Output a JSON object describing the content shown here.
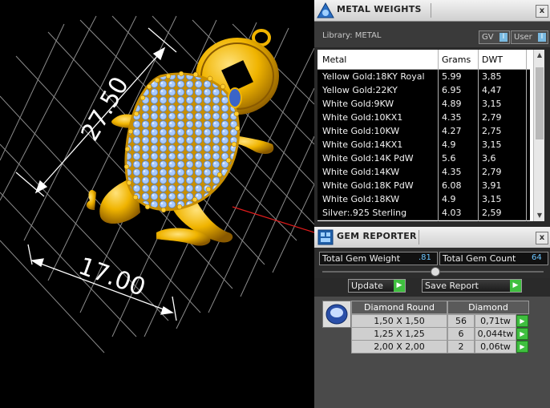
{
  "viewport": {
    "dim_vertical": "27.50",
    "dim_horizontal": "17.00"
  },
  "metal_weights": {
    "title": "METAL WEIGHTS",
    "close_label": "x",
    "library_label": "Library: METAL",
    "gv_label": "GV",
    "user_label": "User",
    "columns": [
      "Metal",
      "Grams",
      "DWT"
    ],
    "rows": [
      {
        "metal": "Yellow Gold:18KY Royal",
        "grams": "5.99",
        "dwt": "3,85"
      },
      {
        "metal": "Yellow Gold:22KY",
        "grams": "6.95",
        "dwt": "4,47"
      },
      {
        "metal": "White Gold:9KW",
        "grams": "4.89",
        "dwt": "3,15"
      },
      {
        "metal": "White Gold:10KX1",
        "grams": "4.35",
        "dwt": "2,79"
      },
      {
        "metal": "White Gold:10KW",
        "grams": "4.27",
        "dwt": "2,75"
      },
      {
        "metal": "White Gold:14KX1",
        "grams": "4.9",
        "dwt": "3,15"
      },
      {
        "metal": "White Gold:14K PdW",
        "grams": "5.6",
        "dwt": "3,6"
      },
      {
        "metal": "White Gold:14KW",
        "grams": "4.35",
        "dwt": "2,79"
      },
      {
        "metal": "White Gold:18K PdW",
        "grams": "6.08",
        "dwt": "3,91"
      },
      {
        "metal": "White Gold:18KW",
        "grams": "4.9",
        "dwt": "3,15"
      },
      {
        "metal": "Silver:.925 Sterling",
        "grams": "4.03",
        "dwt": "2,59"
      }
    ]
  },
  "gem_reporter": {
    "title": "GEM REPORTER",
    "close_label": "x",
    "total_weight_label": "Total Gem Weight",
    "total_weight_value": ".81",
    "total_count_label": "Total Gem Count",
    "total_count_value": "64",
    "update_label": "Update",
    "save_label": "Save Report",
    "gem_shape": "Diamond Round",
    "gem_type": "Diamond",
    "gems": [
      {
        "size": "1,50 X 1,50",
        "count": "56",
        "weight": "0,71tw"
      },
      {
        "size": "1,25 X 1,25",
        "count": "6",
        "weight": "0,044tw"
      },
      {
        "size": "2,00 X 2,00",
        "count": "2",
        "weight": "0,06tw"
      }
    ]
  },
  "colors": {
    "gold": "#f0b400",
    "gem": "#8fb8f0",
    "grid": "#8a8a8a",
    "accent_green": "#3fbf3f",
    "value_blue": "#6cc6ff"
  }
}
